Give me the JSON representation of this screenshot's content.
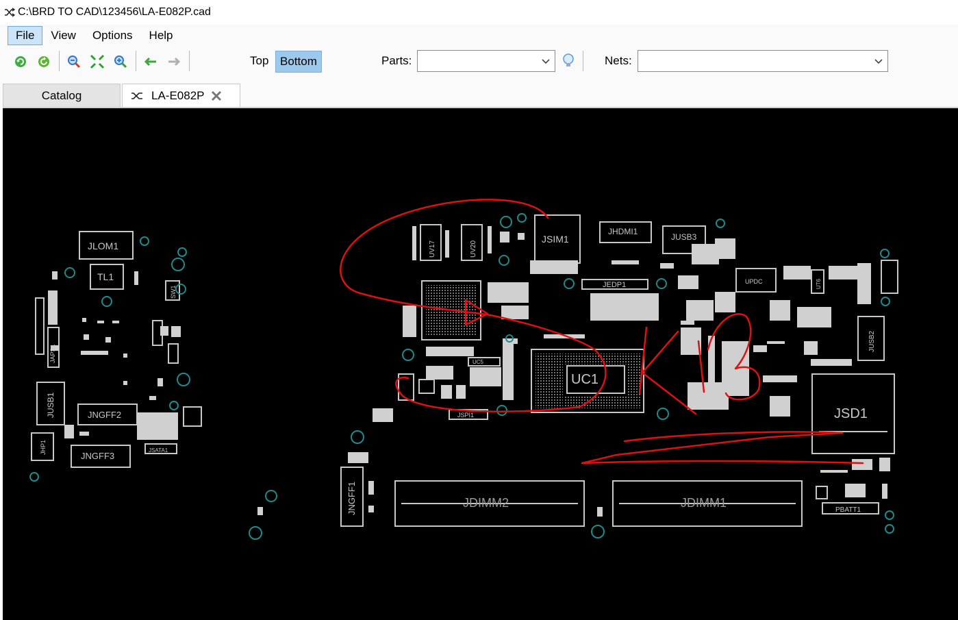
{
  "window": {
    "title": "C:\\BRD TO CAD\\123456\\LA-E082P.cad"
  },
  "menu": {
    "items": [
      "File",
      "View",
      "Options",
      "Help"
    ]
  },
  "toolbar": {
    "layers": {
      "top": "Top",
      "bottom": "Bottom",
      "active": "Bottom"
    },
    "parts_label": "Parts:",
    "parts_value": "",
    "nets_label": "Nets:",
    "nets_value": ""
  },
  "tabs": [
    {
      "label": "Catalog",
      "active": false
    },
    {
      "label": "LA-E082P",
      "active": true,
      "closable": true
    }
  ],
  "board": {
    "labels": {
      "jlom1": "JLOM1",
      "tl1": "TL1",
      "jusb1": "JUSB1",
      "jngff2": "JNGFF2",
      "jngff3": "JNGFF3",
      "jhp1": "JHP1",
      "jsata1": "JSATA1",
      "jmic1": "JAPS1",
      "sw1": "SW1",
      "uv17": "UV17",
      "uv20": "UV20",
      "jsim1": "JSIM1",
      "jhdmi1": "JHDMI1",
      "jusb3": "JUSB3",
      "jedp1": "JEDP1",
      "uc1": "UC1",
      "uc5": "UC5",
      "jspi1": "JSPI1",
      "upd": "UPDC",
      "ut6": "UT6",
      "jusb2": "JUSB2",
      "jsd1": "JSD1",
      "jngff1": "JNGFF1",
      "jdimm2": "JDIMM2",
      "jdimm1": "JDIMM1",
      "pbatt1": "PBATT1"
    }
  },
  "colors": {
    "canvas": "#000000",
    "silkscreen": "#c8c8c8",
    "via": "#1c8c8c",
    "annotation": "#e01010",
    "accent": "#9cc8ec"
  },
  "icons": {
    "title": "board-shuffle-icon",
    "refresh": "refresh-icon",
    "reload": "reload-icon",
    "zoom_in": "zoom-in-icon",
    "fit": "fit-view-icon",
    "zoom_out": "zoom-out-icon",
    "back": "arrow-left-icon",
    "forward": "arrow-right-icon",
    "bulb": "lightbulb-icon"
  }
}
